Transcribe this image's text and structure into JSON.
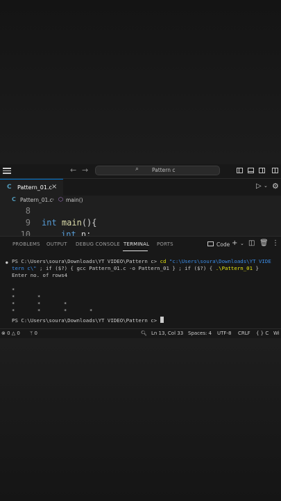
{
  "titlebar": {
    "search_text": "Pattern c"
  },
  "tab": {
    "filename": "Pattern_01.c",
    "lang_glyph": "C"
  },
  "breadcrumb": {
    "file": "Pattern_01.c",
    "symbol": "main()"
  },
  "editor": {
    "lines": [
      {
        "number": "8",
        "text": ""
      },
      {
        "number": "9",
        "keyword": "int",
        "function": "main",
        "rest": "(){"
      },
      {
        "number": "10",
        "keyword": "int",
        "rest": " n;"
      }
    ]
  },
  "panel": {
    "tabs": [
      "PROBLEMS",
      "OUTPUT",
      "DEBUG CONSOLE",
      "TERMINAL",
      "PORTS"
    ],
    "active_tab": "TERMINAL",
    "shell_label": "Code"
  },
  "terminal": {
    "line1_prompt": "PS C:\\Users\\soura\\Downloads\\YT VIDEO\\Pattern c> ",
    "line1_cmd": "cd ",
    "line1_path": "\"c:\\Users\\soura\\Downloads\\YT VIDE",
    "line2_path": "tern c\\\"",
    "line2_mid": " ; if ($?) { gcc Pattern_01.c -o Pattern_01 } ; if ($?) { ",
    "line2_exec": ".\\Pattern_01",
    "line2_end": " }",
    "line3": "Enter no. of rows4",
    "star": "*",
    "star_rows": 4,
    "final_prompt": "PS C:\\Users\\soura\\Downloads\\YT VIDEO\\Pattern c> "
  },
  "statusbar": {
    "errors": "0",
    "warnings": "0",
    "ports": "0",
    "position": "Ln 13, Col 33",
    "spaces": "Spaces: 4",
    "encoding": "UTF-8",
    "eol": "CRLF",
    "language": "C",
    "platform": "Wi"
  }
}
